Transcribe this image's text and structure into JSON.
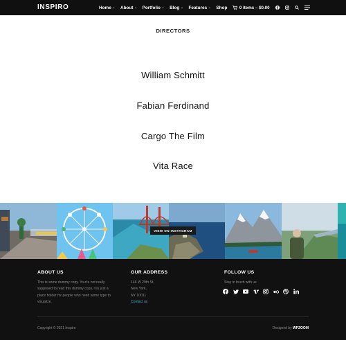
{
  "header": {
    "logo": "INSPIRO",
    "nav": [
      {
        "label": "Home",
        "dropdown": true
      },
      {
        "label": "About",
        "dropdown": true
      },
      {
        "label": "Portfolio",
        "dropdown": true
      },
      {
        "label": "Blog",
        "dropdown": true
      },
      {
        "label": "Features",
        "dropdown": true
      },
      {
        "label": "Shop",
        "dropdown": false
      }
    ],
    "cart": "0 items – $0.00"
  },
  "directors": {
    "title": "DIRECTORS",
    "names": [
      "William Schmitt",
      "Fabian Ferdinand",
      "Cargo The Film",
      "Vita Race"
    ]
  },
  "instagram": {
    "button": "VIEW ON INSTAGRAM",
    "tiles": [
      "street",
      "ferris-wheel",
      "golden-gate",
      "coast",
      "mountain-lake",
      "hiker",
      "sea"
    ]
  },
  "footer": {
    "about": {
      "title": "ABOUT US",
      "text_lines": [
        "This is some dummy copy. You're not really",
        "supposed to read this dummy copy, it is just a",
        "place holder for people who need some type to",
        "visualize."
      ]
    },
    "address": {
      "title": "OUR ADDRESS",
      "lines": [
        "146 W 29th St,",
        "New York,",
        "NY 10011"
      ],
      "link": "Contact us"
    },
    "follow": {
      "title": "FOLLOW US",
      "tagline": "Stay in touch with us",
      "icons": [
        "facebook-icon",
        "twitter-icon",
        "youtube-icon",
        "vimeo-icon",
        "instagram-icon",
        "flickr-icon",
        "dribbble-icon",
        "linkedin-icon"
      ]
    },
    "copyright": "Copyright © 2021 Inspiro",
    "designed_by_prefix": "Designed by",
    "designed_by_brand": "WPZOOM"
  },
  "colors": {
    "header_bg": "#101010",
    "footer_bg": "#111111",
    "link": "#4fb1c6"
  }
}
